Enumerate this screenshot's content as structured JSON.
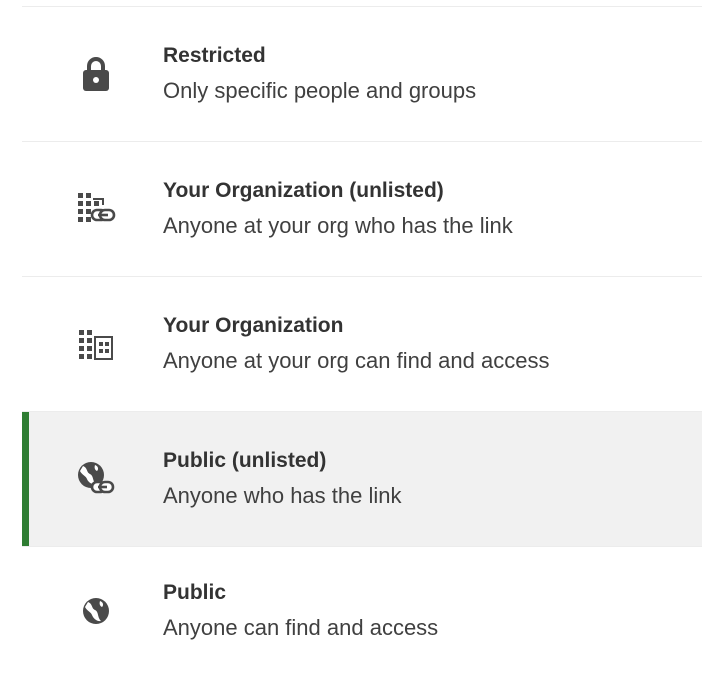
{
  "colors": {
    "selected_accent": "#2e7d32",
    "selected_background": "#f1f1f1",
    "icon": "#4a4a4a",
    "title_text": "#333333",
    "description_text": "#404040",
    "divider": "#ececec"
  },
  "visibility_options": [
    {
      "title": "Restricted",
      "description": "Only specific people and groups",
      "icon": "lock-icon",
      "selected": false
    },
    {
      "title": "Your Organization (unlisted)",
      "description": "Anyone at your org who has the link",
      "icon": "building-link-icon",
      "selected": false
    },
    {
      "title": "Your Organization",
      "description": "Anyone at your org can find and access",
      "icon": "building-icon",
      "selected": false
    },
    {
      "title": "Public (unlisted)",
      "description": "Anyone who has the link",
      "icon": "globe-link-icon",
      "selected": true
    },
    {
      "title": "Public",
      "description": "Anyone can find and access",
      "icon": "globe-icon",
      "selected": false
    }
  ]
}
